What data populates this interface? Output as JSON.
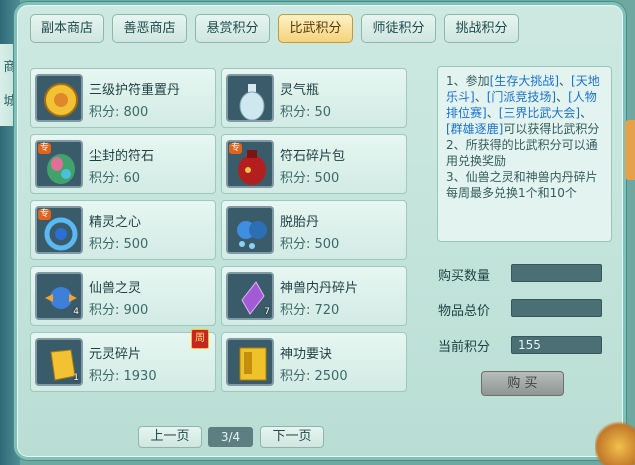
{
  "side_tabs": [
    "商",
    "城"
  ],
  "tabs": [
    {
      "label": "副本商店"
    },
    {
      "label": "善恶商店"
    },
    {
      "label": "悬赏积分"
    },
    {
      "label": "比武积分"
    },
    {
      "label": "师徒积分"
    },
    {
      "label": "挑战积分"
    }
  ],
  "items": [
    {
      "name": "三级护符重置丹",
      "price": "积分: 800",
      "icon": "gold-charm-icon"
    },
    {
      "name": "灵气瓶",
      "price": "积分: 50",
      "icon": "spirit-vase-icon"
    },
    {
      "name": "尘封的符石",
      "price": "积分: 60",
      "icon": "rune-stone-icon",
      "badge": "专"
    },
    {
      "name": "符石碎片包",
      "price": "积分: 500",
      "icon": "rune-bag-icon",
      "badge": "专"
    },
    {
      "name": "精灵之心",
      "price": "积分: 500",
      "icon": "spirit-heart-icon",
      "badge": "专"
    },
    {
      "name": "脱胎丹",
      "price": "积分: 500",
      "icon": "rebirth-pill-icon"
    },
    {
      "name": "仙兽之灵",
      "price": "积分: 900",
      "icon": "beast-spirit-icon",
      "qty": "4"
    },
    {
      "name": "神兽内丹碎片",
      "price": "积分: 720",
      "icon": "beast-core-icon",
      "qty": "7"
    },
    {
      "name": "元灵碎片",
      "price": "积分: 1930",
      "icon": "yuanling-shard-icon",
      "qty": "1",
      "week_tag": "周"
    },
    {
      "name": "神功要诀",
      "price": "积分: 2500",
      "icon": "skill-book-icon"
    }
  ],
  "info": {
    "line1_a": "1、参加",
    "link1": "[生存大挑战]",
    "sep1": "、",
    "link2": "[天地乐斗]",
    "sep2": "、",
    "link3": "[门派竞技场]",
    "sep3": "、",
    "link4": "[人物排位赛]",
    "sep4": "、",
    "link5": "[三界比武大会]",
    "sep5": "、",
    "link6": "[群雄逐鹿]",
    "line1_b": "可以获得比武积分",
    "line2": "2、所获得的比武积分可以通用兑换奖励",
    "line3": "3、仙兽之灵和神兽内丹碎片每周最多兑换1个和10个"
  },
  "form": {
    "qty_label": "购买数量",
    "qty_value": "",
    "total_label": "物品总价",
    "total_value": "",
    "current_label": "当前积分",
    "current_value": "155"
  },
  "buy_label": "购 买",
  "pager": {
    "prev": "上一页",
    "page": "3/4",
    "next": "下一页"
  },
  "colors": {
    "active_tab": "#f3d47c",
    "link": "#1a6fcf",
    "panel": "#c2e3da"
  }
}
